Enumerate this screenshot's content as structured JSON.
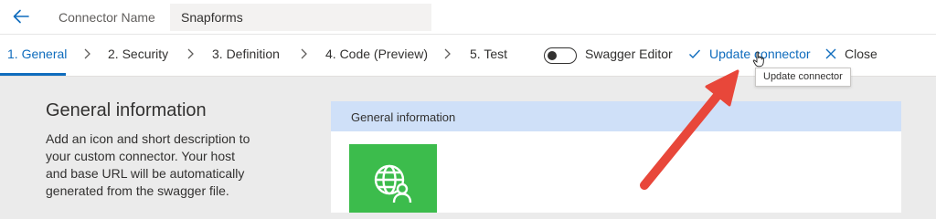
{
  "header": {
    "connector_name_label": "Connector Name",
    "connector_name_value": "Snapforms"
  },
  "steps": [
    {
      "label": "1. General",
      "active": true
    },
    {
      "label": "2. Security",
      "active": false
    },
    {
      "label": "3. Definition",
      "active": false
    },
    {
      "label": "4. Code (Preview)",
      "active": false
    },
    {
      "label": "5. Test",
      "active": false
    }
  ],
  "toolbar": {
    "swagger_toggle_label": "Swagger Editor",
    "swagger_toggle_on": false,
    "update_label": "Update connector",
    "close_label": "Close",
    "tooltip_text": "Update connector"
  },
  "general": {
    "title": "General information",
    "description": "Add an icon and short description to your custom connector. Your host and base URL will be automatically generated from the swagger file.",
    "card_header": "General information"
  },
  "colors": {
    "accent": "#0f6cbd",
    "card_header_bg": "#cfe0f8",
    "icon_tile_bg": "#3cbc4c",
    "annotation_arrow": "#e8473a"
  },
  "icons": {
    "back": "arrow-left-icon",
    "check": "checkmark-icon",
    "close": "close-x-icon",
    "connector": "globe-user-icon"
  }
}
